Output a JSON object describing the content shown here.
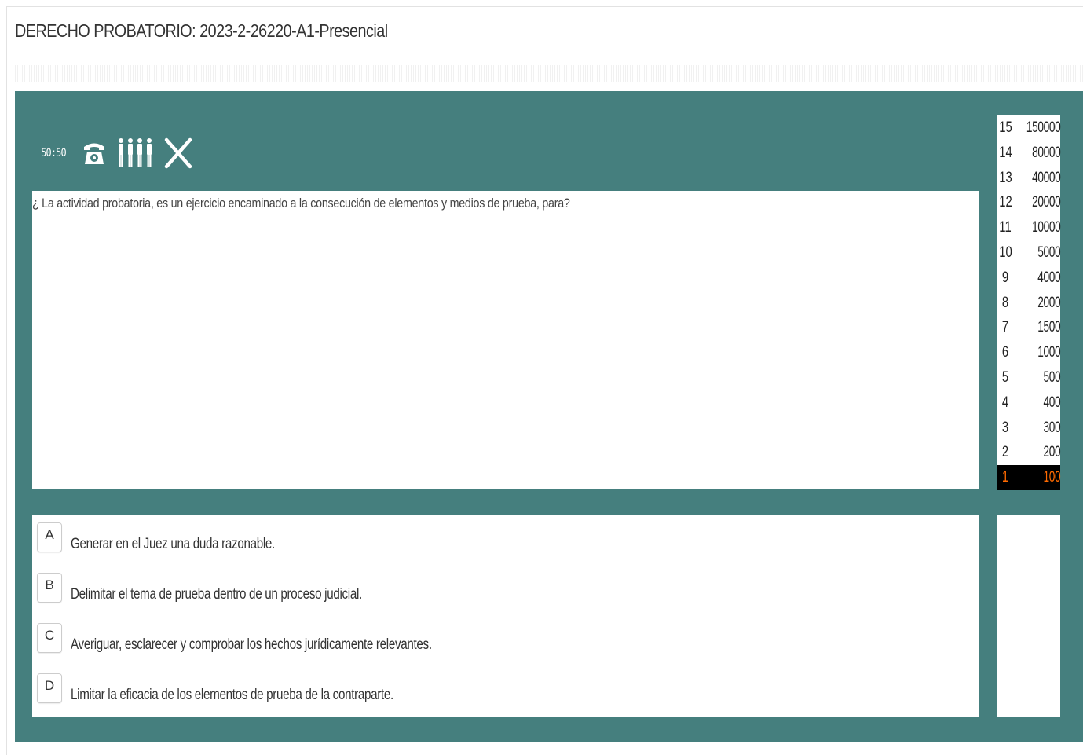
{
  "page": {
    "title": "DERECHO PROBATORIO: 2023-2-26220-A1-Presencial"
  },
  "lifelines": {
    "fifty_fifty_label": "50:50",
    "phone_icon": "phone-icon",
    "audience_icon": "audience-icon",
    "quit_icon": "close-icon"
  },
  "question": {
    "text": "¿ La actividad probatoria, es un ejercicio encaminado a la consecución de elementos y medios de prueba, para?"
  },
  "answers": [
    {
      "letter": "A",
      "text": "Generar en el Juez una duda razonable."
    },
    {
      "letter": "B",
      "text": "Delimitar el tema de prueba dentro de un proceso judicial."
    },
    {
      "letter": "C",
      "text": "Averiguar, esclarecer y comprobar los hechos jurídicamente relevantes."
    },
    {
      "letter": "D",
      "text": "Limitar la eficacia de los elementos de prueba de la contraparte."
    }
  ],
  "prize_ladder": {
    "current_level": "1",
    "rows": [
      {
        "level": "15",
        "amount": "150000"
      },
      {
        "level": "14",
        "amount": "80000"
      },
      {
        "level": "13",
        "amount": "40000"
      },
      {
        "level": "12",
        "amount": "20000"
      },
      {
        "level": "11",
        "amount": "10000"
      },
      {
        "level": "10",
        "amount": "5000"
      },
      {
        "level": "9",
        "amount": "4000"
      },
      {
        "level": "8",
        "amount": "2000"
      },
      {
        "level": "7",
        "amount": "1500"
      },
      {
        "level": "6",
        "amount": "1000"
      },
      {
        "level": "5",
        "amount": "500"
      },
      {
        "level": "4",
        "amount": "400"
      },
      {
        "level": "3",
        "amount": "300"
      },
      {
        "level": "2",
        "amount": "200"
      },
      {
        "level": "1",
        "amount": "100"
      }
    ]
  },
  "colors": {
    "panel": "#457f7e",
    "current_level_bg": "#000000",
    "current_level_text": "#ff6a00"
  }
}
